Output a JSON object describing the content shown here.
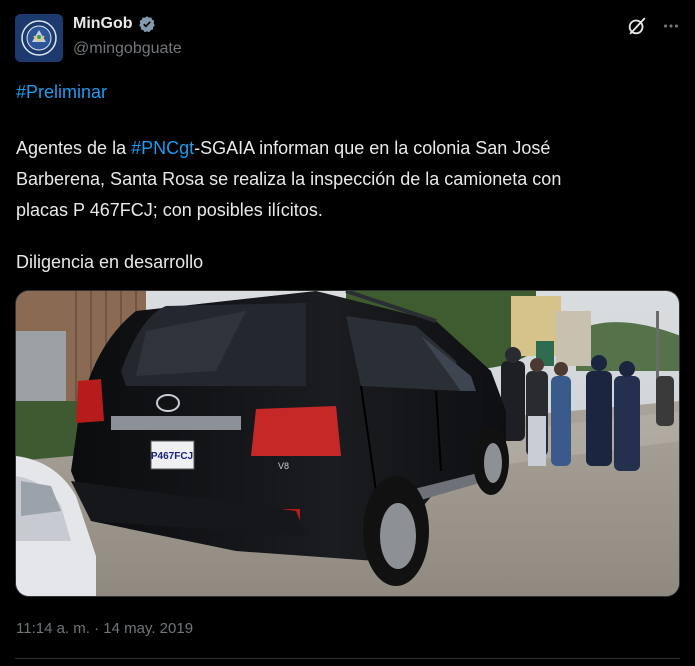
{
  "author": {
    "display_name": "MinGob",
    "handle": "@mingobguate",
    "verified": true,
    "avatar_icon": "guatemala-coat-of-arms-icon"
  },
  "actions": {
    "grok_icon": "grok-icon",
    "more_icon": "more-icon"
  },
  "body": {
    "line1_hashtag": "#Preliminar",
    "p2_prefix": "Agentes de la ",
    "p2_hashtag": "#PNCgt",
    "p2_rest_line1": "-SGAIA informan que en la colonia San José",
    "p2_line2": "Barberena, Santa Rosa se realiza la inspección de la camioneta con",
    "p2_line3": "placas P 467FCJ; con posibles ilícitos.",
    "p3": "Diligencia en desarrollo"
  },
  "media": {
    "plate_text": "P467FCJ",
    "badge_v8": "V8"
  },
  "timestamp": "11:14 a. m. · 14 may. 2019",
  "colors": {
    "background": "#000000",
    "text": "#e7e9ea",
    "secondary": "#71767b",
    "link": "#1d9bf0",
    "border": "#2f3336"
  }
}
